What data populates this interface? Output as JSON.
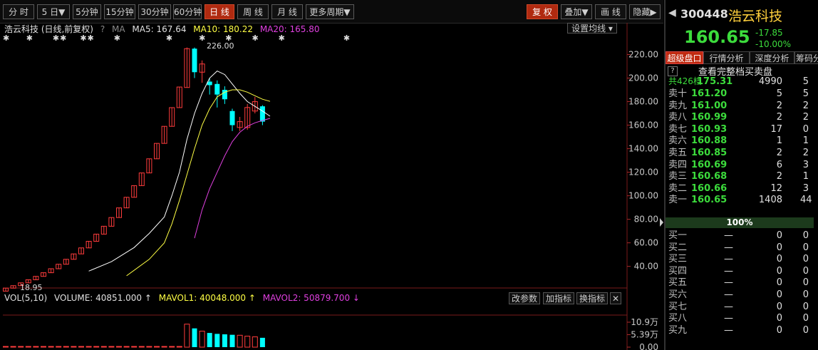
{
  "toolbar": {
    "left_buttons": [
      {
        "label": "分 时",
        "active": false
      },
      {
        "label": "5 日▼",
        "active": false
      },
      {
        "label": "5分钟",
        "active": false
      },
      {
        "label": "15分钟",
        "active": false
      },
      {
        "label": "30分钟",
        "active": false
      },
      {
        "label": "60分钟",
        "active": false
      },
      {
        "label": "日 线",
        "active": true
      },
      {
        "label": "周 线",
        "active": false
      },
      {
        "label": "月 线",
        "active": false
      },
      {
        "label": "更多周期▼",
        "active": false
      }
    ],
    "right_buttons": [
      {
        "label": "复 权",
        "active": true
      },
      {
        "label": "叠加▼",
        "active": false
      },
      {
        "label": "画 线",
        "active": false
      },
      {
        "label": "隐藏▶",
        "active": false
      }
    ]
  },
  "legend": {
    "title": "浩云科技 (日线,前复权)",
    "help": "?",
    "ma_label": "MA",
    "ma5": "MA5: 167.64",
    "ma10": "MA10: 180.22",
    "ma20": "MA20: 165.80",
    "set_ma_button": "设置均线 ▾"
  },
  "chart_annotations": {
    "high_label": "226.00",
    "low_label": "18.95"
  },
  "chart_data": {
    "type": "candlestick",
    "y_axis_ticks": [
      "220.00",
      "200.00",
      "180.00",
      "160.00",
      "140.00",
      "120.00",
      "100.00",
      "80.00",
      "60.00",
      "40.00"
    ],
    "ylim": [
      18,
      230
    ],
    "candles": [
      {
        "o": 18.95,
        "h": 21.5,
        "l": 18.95,
        "c": 21.5,
        "up": true
      },
      {
        "o": 21.5,
        "h": 23.6,
        "l": 21.5,
        "c": 23.6,
        "up": true
      },
      {
        "o": 23.6,
        "h": 26,
        "l": 23.6,
        "c": 26,
        "up": true
      },
      {
        "o": 26,
        "h": 28.6,
        "l": 26,
        "c": 28.6,
        "up": true
      },
      {
        "o": 28.6,
        "h": 31.5,
        "l": 28.6,
        "c": 31.5,
        "up": true
      },
      {
        "o": 31.5,
        "h": 34.6,
        "l": 31.5,
        "c": 34.6,
        "up": true
      },
      {
        "o": 34.6,
        "h": 38,
        "l": 34.6,
        "c": 38,
        "up": true
      },
      {
        "o": 38,
        "h": 41.8,
        "l": 38,
        "c": 41.8,
        "up": true
      },
      {
        "o": 41.8,
        "h": 46,
        "l": 41.8,
        "c": 46,
        "up": true
      },
      {
        "o": 46,
        "h": 50.6,
        "l": 46,
        "c": 50.6,
        "up": true
      },
      {
        "o": 50.6,
        "h": 55.7,
        "l": 50.6,
        "c": 55.7,
        "up": true
      },
      {
        "o": 55.7,
        "h": 61.3,
        "l": 55.7,
        "c": 61.3,
        "up": true
      },
      {
        "o": 61.3,
        "h": 67.4,
        "l": 61.3,
        "c": 67.4,
        "up": true
      },
      {
        "o": 67.4,
        "h": 74.1,
        "l": 67.4,
        "c": 74.1,
        "up": true
      },
      {
        "o": 74.1,
        "h": 81.5,
        "l": 74.1,
        "c": 81.5,
        "up": true
      },
      {
        "o": 81.5,
        "h": 89.7,
        "l": 81.5,
        "c": 89.7,
        "up": true
      },
      {
        "o": 89.7,
        "h": 98.7,
        "l": 89.7,
        "c": 98.7,
        "up": true
      },
      {
        "o": 98.7,
        "h": 108.6,
        "l": 98.7,
        "c": 108.6,
        "up": true
      },
      {
        "o": 108.6,
        "h": 119.4,
        "l": 108.6,
        "c": 119.4,
        "up": true
      },
      {
        "o": 119.4,
        "h": 131.4,
        "l": 119.4,
        "c": 131.4,
        "up": true
      },
      {
        "o": 131.4,
        "h": 144.5,
        "l": 131.4,
        "c": 144.5,
        "up": true
      },
      {
        "o": 144.5,
        "h": 159,
        "l": 144.5,
        "c": 159,
        "up": true
      },
      {
        "o": 159,
        "h": 174.9,
        "l": 159,
        "c": 174.9,
        "up": true
      },
      {
        "o": 174.9,
        "h": 192.4,
        "l": 174.9,
        "c": 192.4,
        "up": true
      },
      {
        "o": 192,
        "h": 226,
        "l": 192,
        "c": 225,
        "up": true
      },
      {
        "o": 225,
        "h": 226,
        "l": 200,
        "c": 205,
        "up": false
      },
      {
        "o": 205,
        "h": 215,
        "l": 196,
        "c": 212,
        "up": true
      },
      {
        "o": 197,
        "h": 200,
        "l": 186,
        "c": 194,
        "up": false
      },
      {
        "o": 195,
        "h": 198,
        "l": 175,
        "c": 186,
        "up": false
      },
      {
        "o": 190,
        "h": 193,
        "l": 178,
        "c": 182,
        "up": false
      },
      {
        "o": 172,
        "h": 174,
        "l": 155,
        "c": 160,
        "up": false
      },
      {
        "o": 158,
        "h": 167,
        "l": 155,
        "c": 163,
        "up": true
      },
      {
        "o": 158,
        "h": 178,
        "l": 156,
        "c": 175,
        "up": true
      },
      {
        "o": 172,
        "h": 184,
        "l": 170,
        "c": 180,
        "up": true
      },
      {
        "o": 176,
        "h": 177,
        "l": 160,
        "c": 163,
        "up": false
      }
    ],
    "ma_series": [
      {
        "name": "MA5",
        "color": "#ffffff",
        "points": [
          [
            11,
            36
          ],
          [
            14,
            44
          ],
          [
            17,
            56
          ],
          [
            19,
            68
          ],
          [
            21,
            82
          ],
          [
            22,
            100
          ],
          [
            23,
            120
          ],
          [
            24,
            148
          ],
          [
            25,
            170
          ],
          [
            26,
            187
          ],
          [
            27,
            200
          ],
          [
            28,
            206
          ],
          [
            29,
            203
          ],
          [
            30,
            195
          ],
          [
            31,
            187
          ],
          [
            32,
            180
          ],
          [
            33,
            176
          ],
          [
            34,
            172
          ],
          [
            35,
            167.64
          ]
        ]
      },
      {
        "name": "MA10",
        "color": "#ffff44",
        "points": [
          [
            16,
            32
          ],
          [
            19,
            46
          ],
          [
            21,
            60
          ],
          [
            22,
            76
          ],
          [
            23,
            96
          ],
          [
            24,
            118
          ],
          [
            25,
            140
          ],
          [
            26,
            160
          ],
          [
            27,
            174
          ],
          [
            28,
            184
          ],
          [
            29,
            188
          ],
          [
            30,
            190
          ],
          [
            31,
            190
          ],
          [
            32,
            188
          ],
          [
            33,
            185
          ],
          [
            34,
            182
          ],
          [
            35,
            180.22
          ]
        ]
      },
      {
        "name": "MA20",
        "color": "#e040e0",
        "points": [
          [
            25,
            64
          ],
          [
            26,
            88
          ],
          [
            27,
            106
          ],
          [
            28,
            120
          ],
          [
            29,
            134
          ],
          [
            30,
            146
          ],
          [
            31,
            154
          ],
          [
            32,
            159
          ],
          [
            33,
            162
          ],
          [
            34,
            164
          ],
          [
            35,
            165.8
          ]
        ]
      }
    ],
    "star_markers": "✱     ✱      ✱✱    ✱✱      ✱              ✱        ✱      ✱      ✱      ✱                  ✱",
    "volume_ticks": [
      "10.9万",
      "5.39万",
      "0.00"
    ],
    "volume_max": 109000,
    "volumes": [
      120,
      150,
      180,
      200,
      220,
      240,
      260,
      300,
      340,
      360,
      400,
      420,
      460,
      500,
      540,
      560,
      600,
      640,
      700,
      760,
      820,
      900,
      1000,
      1500,
      100500,
      82000,
      70000,
      62000,
      58000,
      56000,
      54000,
      52000,
      48000,
      45000,
      40851
    ]
  },
  "vol_legend": {
    "label": "VOL(5,10)",
    "volume": "VOLUME: 40851.000 ↑",
    "mavol1": "MAVOL1: 40048.000 ↑",
    "mavol2": "MAVOL2: 50879.700 ↓",
    "buttons": [
      "改参数",
      "加指标",
      "换指标",
      "✕"
    ]
  },
  "quote": {
    "code": "300448",
    "name": "浩云科技",
    "price": "160.65",
    "change": "-17.85",
    "change_pct": "-10.00%",
    "tabs": [
      "超级盘口",
      "行情分析",
      "深度分析",
      "筹码分"
    ],
    "help": "?",
    "full_book_link": "查看完整档买卖盘",
    "total_row": {
      "label": "共426档",
      "price": "175.31",
      "vol": "4990",
      "ext": "5"
    },
    "asks": [
      {
        "label": "卖十",
        "price": "161.20",
        "vol": "5",
        "ext": "5"
      },
      {
        "label": "卖九",
        "price": "161.00",
        "vol": "2",
        "ext": "2"
      },
      {
        "label": "卖八",
        "price": "160.99",
        "vol": "2",
        "ext": "2"
      },
      {
        "label": "卖七",
        "price": "160.93",
        "vol": "17",
        "ext": "0"
      },
      {
        "label": "卖六",
        "price": "160.88",
        "vol": "1",
        "ext": "1"
      },
      {
        "label": "卖五",
        "price": "160.85",
        "vol": "2",
        "ext": "2"
      },
      {
        "label": "卖四",
        "price": "160.69",
        "vol": "6",
        "ext": "3"
      },
      {
        "label": "卖三",
        "price": "160.68",
        "vol": "2",
        "ext": "1"
      },
      {
        "label": "卖二",
        "price": "160.66",
        "vol": "12",
        "ext": "3"
      },
      {
        "label": "卖一",
        "price": "160.65",
        "vol": "1408",
        "ext": "44"
      }
    ],
    "pct_bar": "100%",
    "bids": [
      {
        "label": "买一",
        "price": "—",
        "vol": "0",
        "ext": "0"
      },
      {
        "label": "买二",
        "price": "—",
        "vol": "0",
        "ext": "0"
      },
      {
        "label": "买三",
        "price": "—",
        "vol": "0",
        "ext": "0"
      },
      {
        "label": "买四",
        "price": "—",
        "vol": "0",
        "ext": "0"
      },
      {
        "label": "买五",
        "price": "—",
        "vol": "0",
        "ext": "0"
      },
      {
        "label": "买六",
        "price": "—",
        "vol": "0",
        "ext": "0"
      },
      {
        "label": "买七",
        "price": "—",
        "vol": "0",
        "ext": "0"
      },
      {
        "label": "买八",
        "price": "—",
        "vol": "0",
        "ext": "0"
      },
      {
        "label": "买九",
        "price": "—",
        "vol": "0",
        "ext": "0"
      }
    ],
    "colors": {
      "up": "#ff3c3c",
      "down": "#00ffff",
      "green": "#3cdc3c",
      "accent": "#c02a10"
    }
  }
}
